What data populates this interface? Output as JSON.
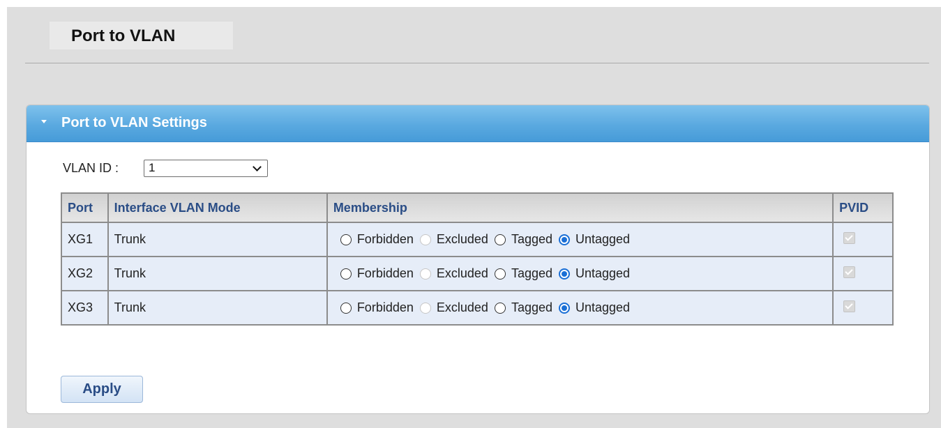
{
  "page": {
    "title": "Port to VLAN"
  },
  "panel": {
    "title": "Port to VLAN Settings"
  },
  "vlan": {
    "label": "VLAN ID :",
    "selected": "1"
  },
  "table": {
    "headers": [
      "Port",
      "Interface VLAN Mode",
      "Membership",
      "PVID"
    ],
    "membership_options": [
      "Forbidden",
      "Excluded",
      "Tagged",
      "Untagged"
    ],
    "rows": [
      {
        "port": "XG1",
        "mode": "Trunk",
        "membership": "Untagged",
        "excluded_disabled": true,
        "pvid_checked": true,
        "pvid_disabled": true
      },
      {
        "port": "XG2",
        "mode": "Trunk",
        "membership": "Untagged",
        "excluded_disabled": true,
        "pvid_checked": true,
        "pvid_disabled": true
      },
      {
        "port": "XG3",
        "mode": "Trunk",
        "membership": "Untagged",
        "excluded_disabled": true,
        "pvid_checked": true,
        "pvid_disabled": true
      }
    ]
  },
  "actions": {
    "apply_label": "Apply"
  },
  "colors": {
    "header_blue": "#5aa9e0",
    "header_text": "#2a4d86",
    "row_bg": "#e6edf8",
    "radio_checked": "#1a6fd6"
  }
}
